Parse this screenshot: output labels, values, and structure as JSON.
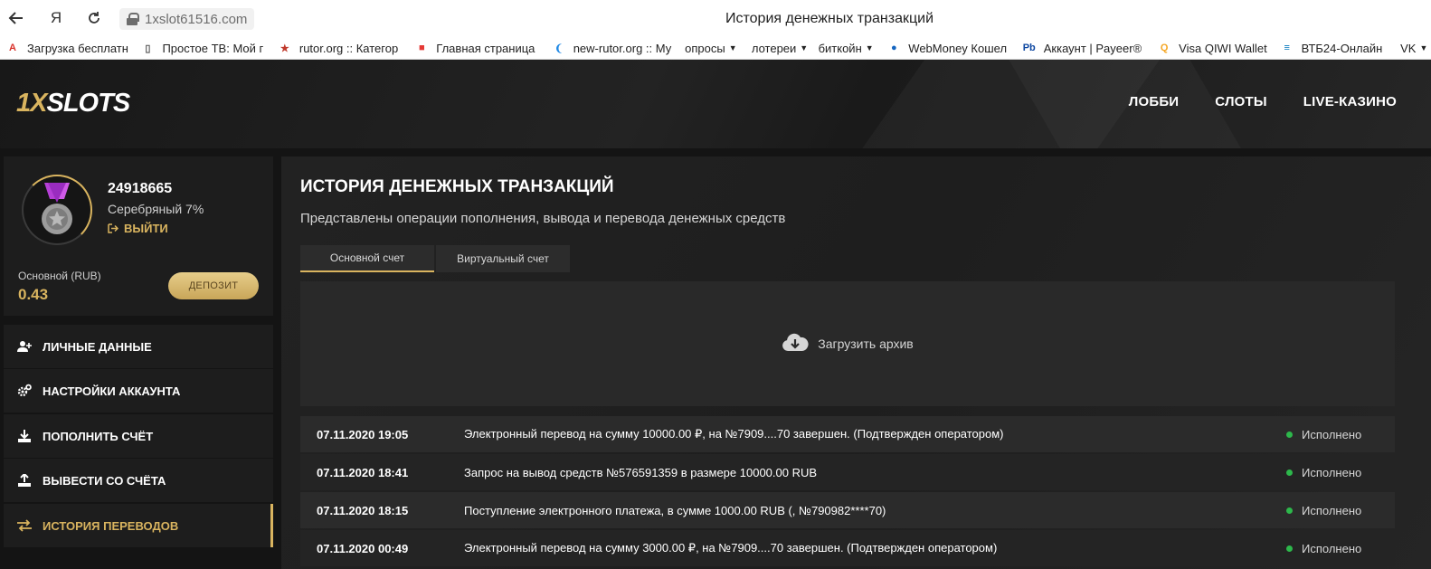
{
  "browser": {
    "url": "1xslot61516.com",
    "tab_title": "История денежных транзакций",
    "yandex_glyph": "Я",
    "bookmarks": [
      {
        "label": "Загрузка бесплатн",
        "icon": "adobe-icon",
        "color": "#d8312a",
        "dropdown": false
      },
      {
        "label": "Простое ТВ: Мой г",
        "icon": "page-icon",
        "color": "#555555",
        "dropdown": false
      },
      {
        "label": "rutor.org :: Категор",
        "icon": "star-icon",
        "color": "#c0392b",
        "dropdown": false
      },
      {
        "label": "Главная страница",
        "icon": "news-icon",
        "color": "#e53935",
        "dropdown": false
      },
      {
        "label": "new-rutor.org :: Му",
        "icon": "drop-icon",
        "color": "#1e88e5",
        "dropdown": false
      },
      {
        "label": "опросы",
        "icon": "",
        "color": "",
        "dropdown": true
      },
      {
        "label": "лотереи",
        "icon": "",
        "color": "",
        "dropdown": true
      },
      {
        "label": "биткойн",
        "icon": "",
        "color": "",
        "dropdown": true
      },
      {
        "label": "WebMoney Кошел",
        "icon": "globe-icon",
        "color": "#1565c0",
        "dropdown": false
      },
      {
        "label": "Аккаунт | Payeer®",
        "icon": "payeer-icon",
        "color": "#0d47a1",
        "dropdown": false
      },
      {
        "label": "Visa QIWI Wallet",
        "icon": "qiwi-icon",
        "color": "#f5a623",
        "dropdown": false
      },
      {
        "label": "ВТБ24-Онлайн",
        "icon": "vtb-icon",
        "color": "#0277bd",
        "dropdown": false
      },
      {
        "label": "VK",
        "icon": "",
        "color": "",
        "dropdown": true
      }
    ]
  },
  "site": {
    "logo_part1": "1X",
    "logo_part2": "SLOTS",
    "nav": [
      "ЛОББИ",
      "СЛОТЫ",
      "LIVE-КАЗИНО"
    ]
  },
  "profile": {
    "user_id": "24918665",
    "level": "Серебряный 7%",
    "logout": "ВЫЙТИ",
    "balance_label": "Основной (RUB)",
    "balance_value": "0.43",
    "deposit": "ДЕПОЗИТ"
  },
  "menu": [
    {
      "label": "ЛИЧНЫЕ ДАННЫЕ",
      "icon": "user-plus-icon",
      "active": false
    },
    {
      "label": "НАСТРОЙКИ АККАУНТА",
      "icon": "gears-icon",
      "active": false
    },
    {
      "label": "ПОПОЛНИТЬ СЧЁТ",
      "icon": "download-icon",
      "active": false
    },
    {
      "label": "ВЫВЕСТИ СО СЧЁТА",
      "icon": "upload-icon",
      "active": false
    },
    {
      "label": "ИСТОРИЯ ПЕРЕВОДОВ",
      "icon": "exchange-icon",
      "active": true
    }
  ],
  "main": {
    "title": "ИСТОРИЯ ДЕНЕЖНЫХ ТРАНЗАКЦИЙ",
    "subtitle": "Представлены операции пополнения, вывода и перевода денежных средств",
    "tabs": [
      {
        "label": "Основной счет",
        "active": true
      },
      {
        "label": "Виртуальный счет",
        "active": false
      }
    ],
    "archive_label": "Загрузить архив",
    "transactions": [
      {
        "date": "07.11.2020 19:05",
        "description": "Электронный перевод на сумму 10000.00 ₽, на №7909....70 завершен. (Подтвержден оператором)",
        "status": "Исполнено"
      },
      {
        "date": "07.11.2020 18:41",
        "description": "Запрос на вывод средств №576591359 в размере 10000.00 RUB",
        "status": "Исполнено"
      },
      {
        "date": "07.11.2020 18:15",
        "description": "Поступление электронного платежа, в сумме 1000.00 RUB (, №790982****70)",
        "status": "Исполнено"
      },
      {
        "date": "07.11.2020 00:49",
        "description": "Электронный перевод на сумму 3000.00 ₽, на №7909....70 завершен. (Подтвержден оператором)",
        "status": "Исполнено"
      }
    ]
  },
  "colors": {
    "accent_gold": "#d9b45f",
    "status_green": "#2db84b"
  }
}
